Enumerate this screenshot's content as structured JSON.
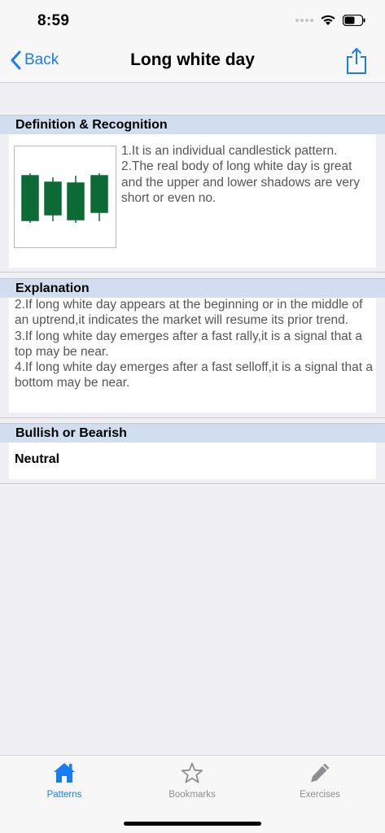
{
  "status": {
    "time": "8:59"
  },
  "nav": {
    "back_label": "Back",
    "title": "Long white day"
  },
  "sections": {
    "definition": {
      "header": "Definition & Recognition",
      "text": "1.It is an individual candlestick pattern.\n2.The real body of long white day is great and the upper and lower shadows are very short or even no."
    },
    "explanation": {
      "header": "Explanation",
      "text": "2.If long white day appears at the beginning or in the middle of an uptrend,it indicates the market will resume its prior trend.\n3.If long white day emerges after a fast rally,it is a signal that a top may be near.\n4.If long white day emerges after a fast selloff,it is a signal that a bottom may be near."
    },
    "bullish": {
      "header": "Bullish or Bearish",
      "value": "Neutral"
    }
  },
  "tabs": [
    {
      "label": "Patterns",
      "icon": "home-icon",
      "active": true
    },
    {
      "label": "Bookmarks",
      "icon": "star-icon",
      "active": false
    },
    {
      "label": "Exercises",
      "icon": "pencil-icon",
      "active": false
    }
  ],
  "colors": {
    "accent": "#1a7cf5",
    "candle": "#0c6b35",
    "section_header": "#d0deef",
    "tab_inactive": "#8e8e93"
  }
}
